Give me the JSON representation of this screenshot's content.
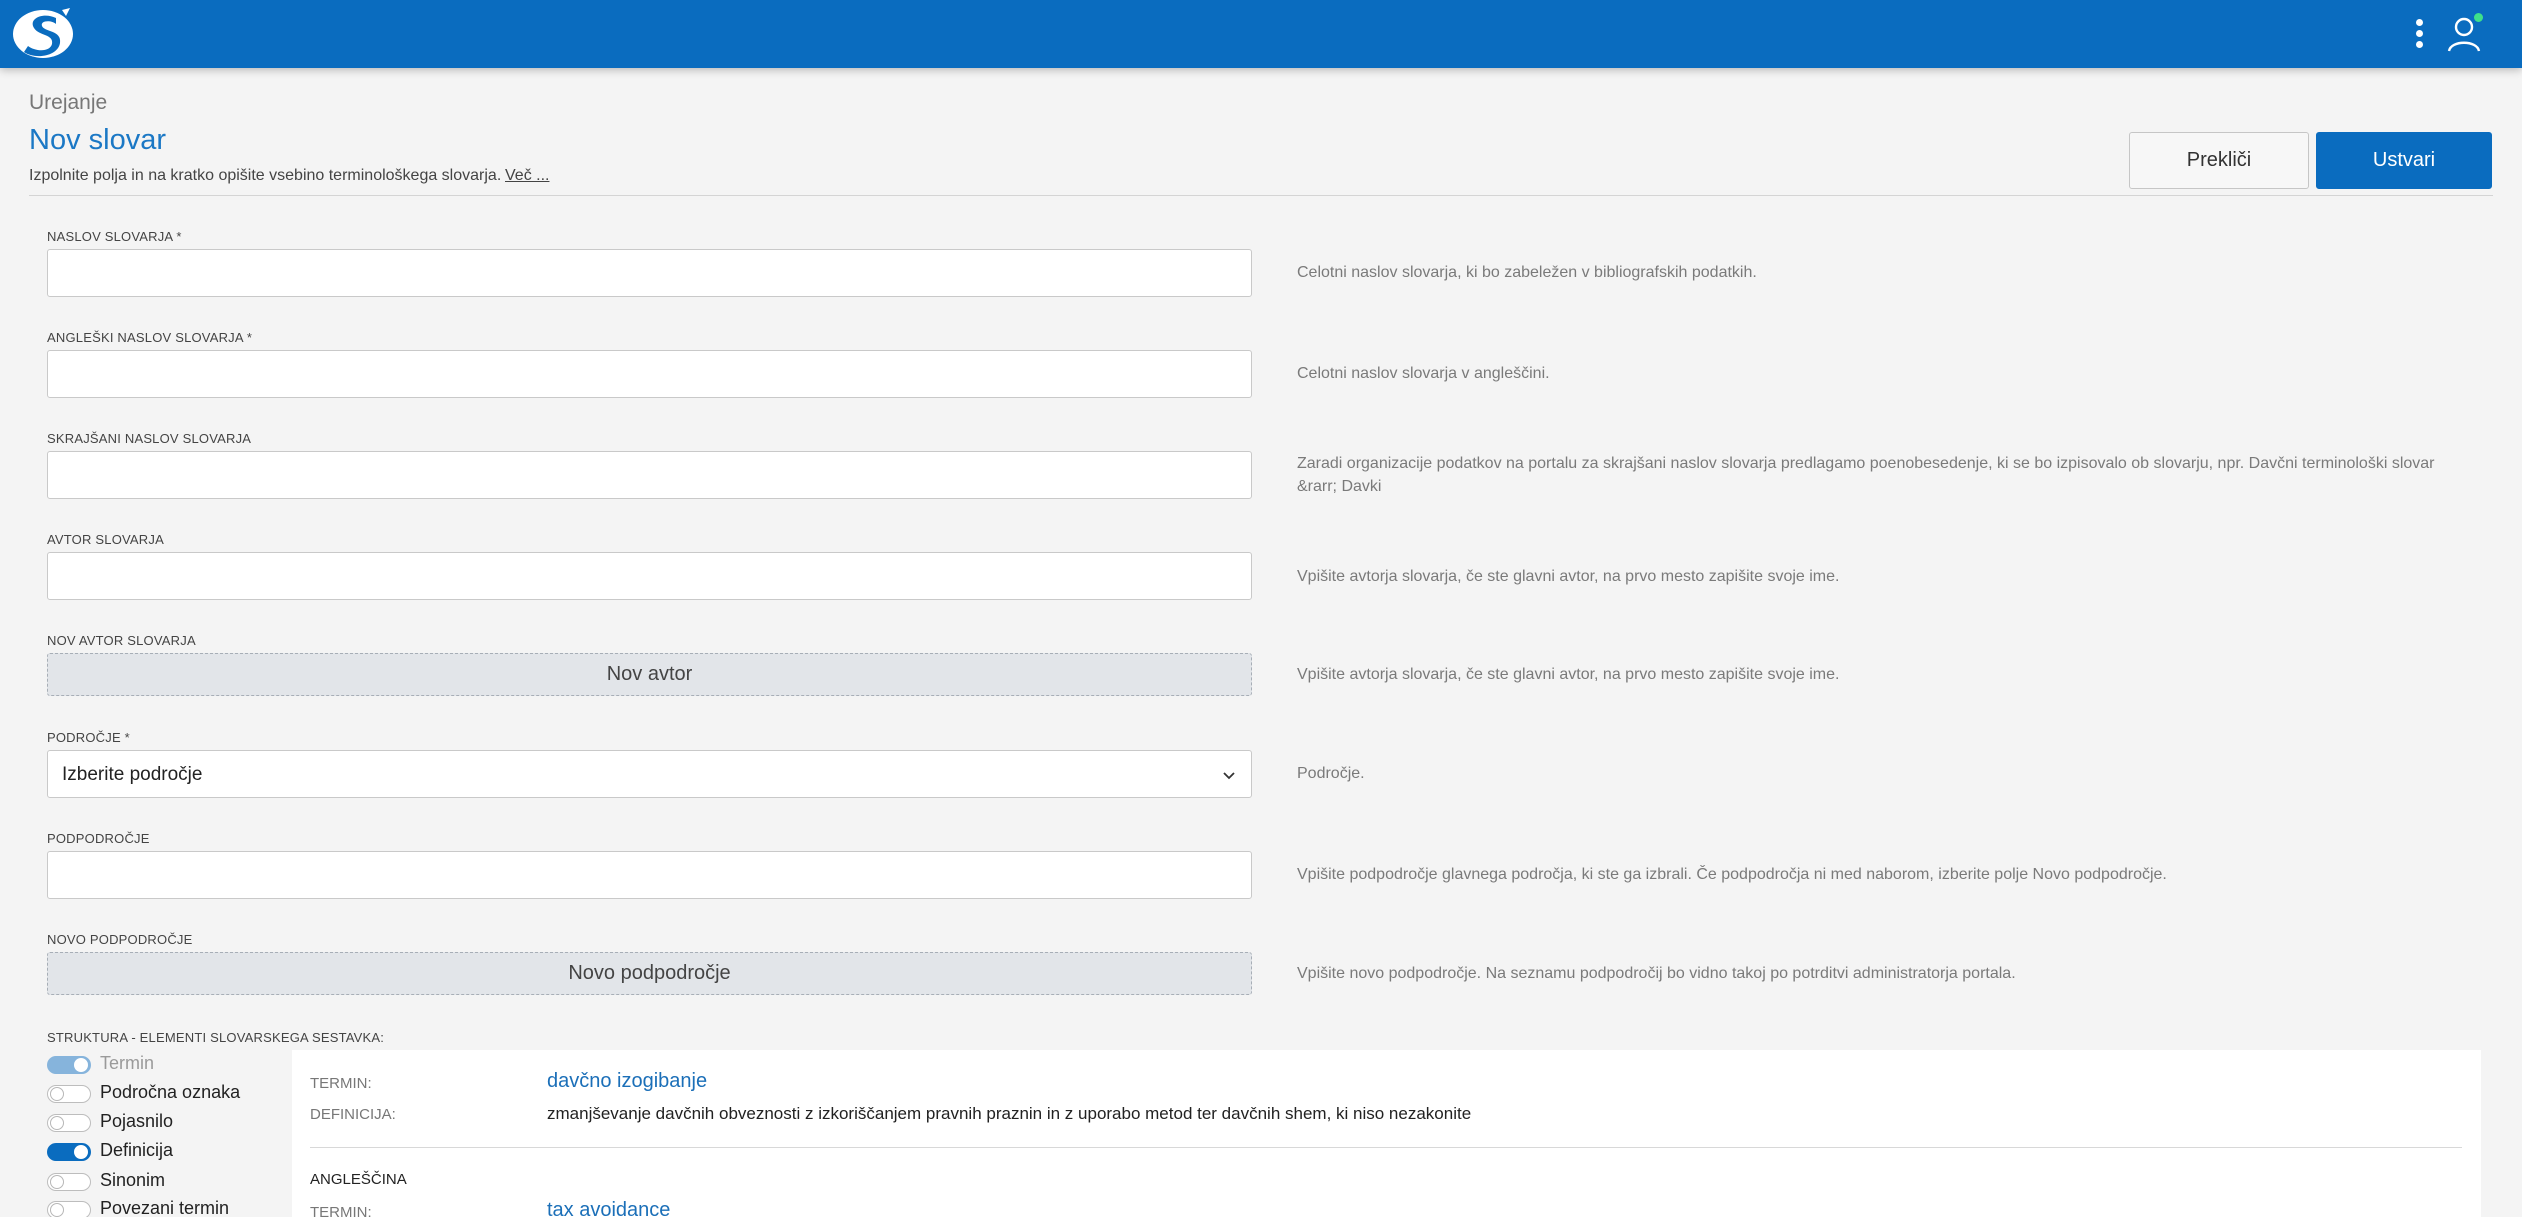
{
  "header": {
    "breadcrumb": "Urejanje",
    "title": "Nov slovar",
    "subtitle": "Izpolnite polja in na kratko opišite vsebino terminološkega slovarja.",
    "more_link": "Več ...",
    "cancel_label": "Prekliči",
    "create_label": "Ustvari"
  },
  "colors": {
    "brand": "#0a6cbf",
    "accent_title": "#1b78c5",
    "online": "#3ee08a"
  },
  "icons": {
    "logo": "slovar-logo-icon",
    "menu": "vertical-dots-icon",
    "user": "user-icon",
    "select": "chevron-down-icon"
  },
  "form": {
    "title": {
      "label": "NASLOV SLOVARJA *",
      "value": "",
      "help": "Celotni naslov slovarja, ki bo zabeležen v bibliografskih podatkih."
    },
    "english_title": {
      "label": "ANGLEŠKI NASLOV SLOVARJA *",
      "value": "",
      "help": "Celotni naslov slovarja v angleščini."
    },
    "short_title": {
      "label": "SKRAJŠANI NASLOV SLOVARJA",
      "value": "",
      "help": "Zaradi organizacije podatkov na portalu za skrajšani naslov slovarja predlagamo poenobesedenje, ki se bo izpisovalo ob slovarju, npr. Davčni terminološki slovar &rarr; Davki"
    },
    "author": {
      "label": "AVTOR SLOVARJA",
      "value": "",
      "help": "Vpišite avtorja slovarja, če ste glavni avtor, na prvo mesto zapišite svoje ime."
    },
    "new_author": {
      "label": "NOV AVTOR SLOVARJA",
      "button": "Nov avtor",
      "help": "Vpišite avtorja slovarja, če ste glavni avtor, na prvo mesto zapišite svoje ime."
    },
    "domain": {
      "label": "PODROČJE *",
      "selected": "Izberite področje",
      "help": "Področje."
    },
    "subdomain": {
      "label": "PODPODROČJE",
      "value": "",
      "help": "Vpišite podpodročje glavnega področja, ki ste ga izbrali. Če podpodročja ni med naborom, izberite polje Novo podpodročje."
    },
    "new_subdomain": {
      "label": "NOVO PODPODROČJE",
      "button": "Novo podpodročje",
      "help": "Vpišite novo podpodročje. Na seznamu podpodročij bo vidno takoj po potrditvi administratorja portala."
    }
  },
  "structure": {
    "label": "STRUKTURA - ELEMENTI SLOVARSKEGA SESTAVKA:",
    "toggles": [
      {
        "label": "Termin",
        "state": "on-disabled"
      },
      {
        "label": "Področna oznaka",
        "state": "off"
      },
      {
        "label": "Pojasnilo",
        "state": "off"
      },
      {
        "label": "Definicija",
        "state": "on"
      },
      {
        "label": "Sinonim",
        "state": "off"
      },
      {
        "label": "Povezani termin",
        "state": "off"
      }
    ]
  },
  "preview": {
    "term_label": "TERMIN:",
    "term": "davčno izogibanje",
    "definition_label": "DEFINICIJA:",
    "definition": "zmanjševanje davčnih obveznosti z izkoriščanjem pravnih praznin in z uporabo metod ter davčnih shem, ki niso nezakonite",
    "english_heading": "ANGLEŠČINA",
    "en_term_label": "TERMIN:",
    "en_term": "tax avoidance"
  }
}
